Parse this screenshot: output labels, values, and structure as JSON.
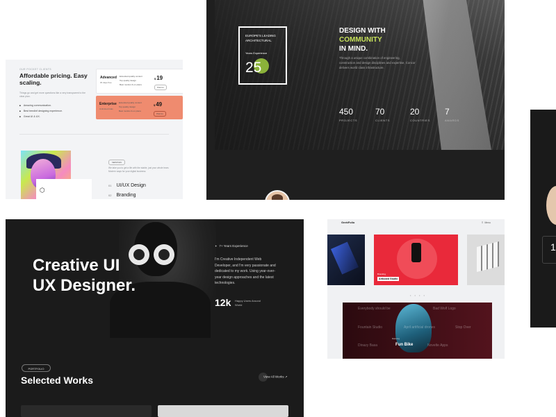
{
  "pricing": {
    "tag": "OUR POCKET CLIENTS",
    "title": "Affordable pricing. Easy scaling.",
    "desc": "Things go and get more questions like a very transparent to the clear plan.",
    "features": [
      "Amazing communication.",
      "Best trendinf designing experience.",
      "Great UI & UX."
    ],
    "plans": [
      {
        "name": "Advanced",
        "sub": "3h days free",
        "features": [
          "Extended quality content",
          "Top quality design",
          "Best monitor & on plans"
        ],
        "currency": "$",
        "price": "19",
        "button": "Pick Us"
      },
      {
        "name": "Enterprise",
        "sub": "Unlimited trials",
        "features": [
          "Extended quality content",
          "Top quality design",
          "Best monitor & on plans"
        ],
        "currency": "$",
        "price": "49",
        "button": "Pick Us"
      }
    ],
    "services_pill": "SERVICES",
    "services_desc": "We take you to get a life with the stable, just your whole team. Modern ways for your digital business.",
    "services": [
      {
        "num": "01",
        "label": "UI/UX Design"
      },
      {
        "num": "02",
        "label": "Branding"
      }
    ]
  },
  "arch": {
    "box_title": "EUROPE'S LEADING ARCHITECTURAL",
    "box_sub": "Years Experience",
    "box_num": "25",
    "headline_1": "DESIGN WITH",
    "headline_accent": "COMMUNITY",
    "headline_2": "IN MIND.",
    "paragraph": "Through a unique combination of engineering, construction and design disciplines and expertise, Concor delivers world class infrastructure.",
    "stats": [
      {
        "value": "450",
        "label": "PROJECTS"
      },
      {
        "value": "70",
        "label": "CLIENTS"
      },
      {
        "value": "20",
        "label": "COUNTRIES"
      },
      {
        "value": "7",
        "label": "AWARDS"
      }
    ]
  },
  "creative": {
    "headline_1": "Creative UI",
    "headline_2": "UX Designer.",
    "experience": "7+ Years Experience",
    "bio": "I'm Creative Independent Web Developer, and I'm very passionate and dedicated to my work. Using year-over-year design approaches and the latest technologies.",
    "stat_value": "12k",
    "stat_label": "Happy Users Around World",
    "section_pill": "PORTFOLIO",
    "section_title": "Selected Works",
    "view_all": "View All Works ↗"
  },
  "geek": {
    "logo": "GeekFolio",
    "menu": "Menu",
    "slide_tag": "Branding",
    "slide_title": "Artboard Studio",
    "dots": "• • • •",
    "words": [
      "Everybody should be",
      "Bad Wolf Logo",
      "Fountain Studio",
      "April artificial drones",
      "Stop Over",
      "Dinazy Basa",
      "Fun Bike",
      "Novelte Apps"
    ],
    "highlight_tag": "Marketing"
  },
  "right": {
    "number": "1"
  },
  "colors": {
    "accent_green": "#c7e25a",
    "enterprise_orange": "#ef8b6f",
    "geek_red": "#e9293a"
  }
}
